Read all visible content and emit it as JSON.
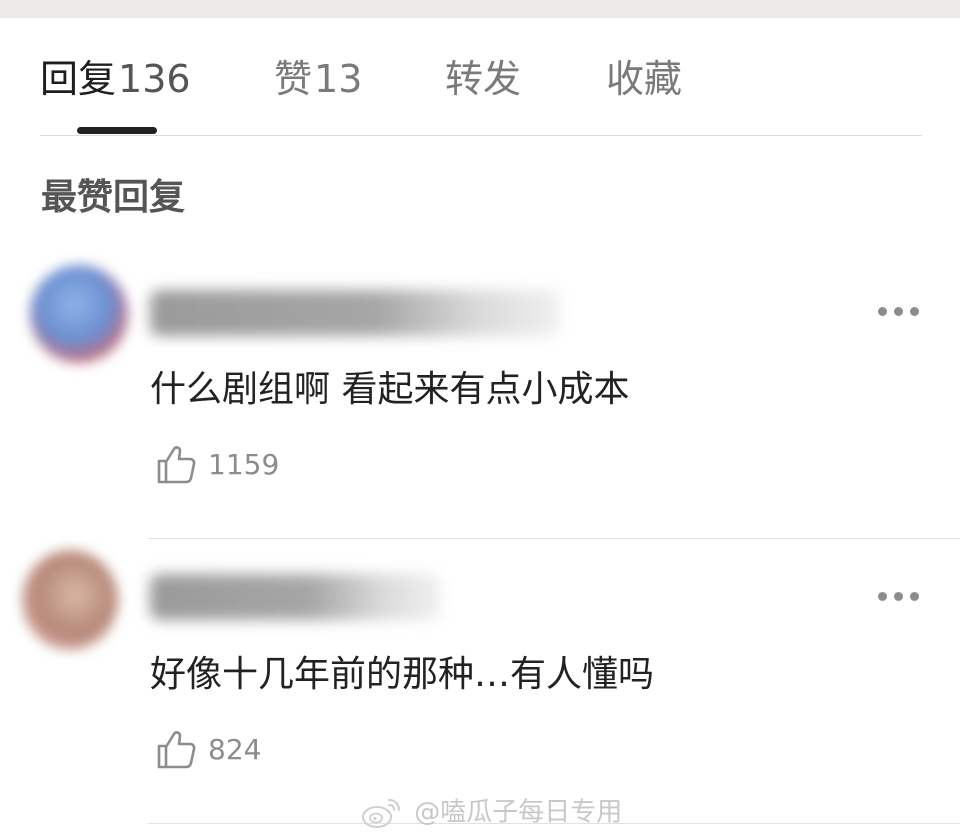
{
  "tabs": [
    {
      "label": "回复",
      "count": "136",
      "active": true
    },
    {
      "label": "赞",
      "count": "13",
      "active": false
    },
    {
      "label": "转发",
      "count": "",
      "active": false
    },
    {
      "label": "收藏",
      "count": "",
      "active": false
    }
  ],
  "section_title": "最赞回复",
  "comments": [
    {
      "text": "什么剧组啊  看起来有点小成本",
      "likes": "1159"
    },
    {
      "text": "好像十几年前的那种…有人懂吗",
      "likes": "824"
    }
  ],
  "watermark": {
    "text": "@嗑瓜子每日专用",
    "icon": "weibo-logo"
  },
  "colors": {
    "top_strip": "#ecebe8",
    "active_tab": "#1e1e1e",
    "inactive_tab": "#7a7a7a",
    "secondary_text": "#8c8c8c"
  }
}
